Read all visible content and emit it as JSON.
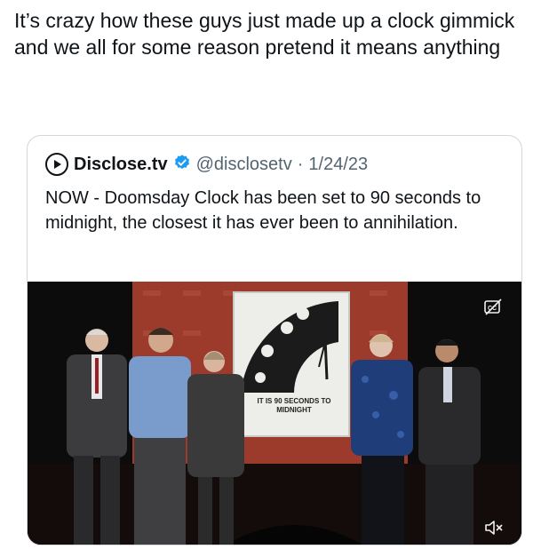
{
  "post": {
    "text": "It’s crazy how these guys just made up a clock gimmick and we all for some reason pretend it means anything"
  },
  "quoted_post": {
    "author_name": "Disclose.tv",
    "handle": "@disclosetv",
    "separator": "·",
    "date": "1/24/23",
    "text": "NOW - Doomsday Clock has been set to 90 seconds to midnight, the closest it has ever been to annihilation.",
    "avatar_icon": "disclose-tv-logo-icon",
    "verified_icon": "verified-badge-icon",
    "verified_color": "#1d9bf0"
  },
  "media": {
    "clock_caption": "IT IS 90 SECONDS TO MIDNIGHT",
    "controls": {
      "captions_icon": "closed-captions-icon",
      "mute_icon": "volume-muted-icon"
    }
  }
}
